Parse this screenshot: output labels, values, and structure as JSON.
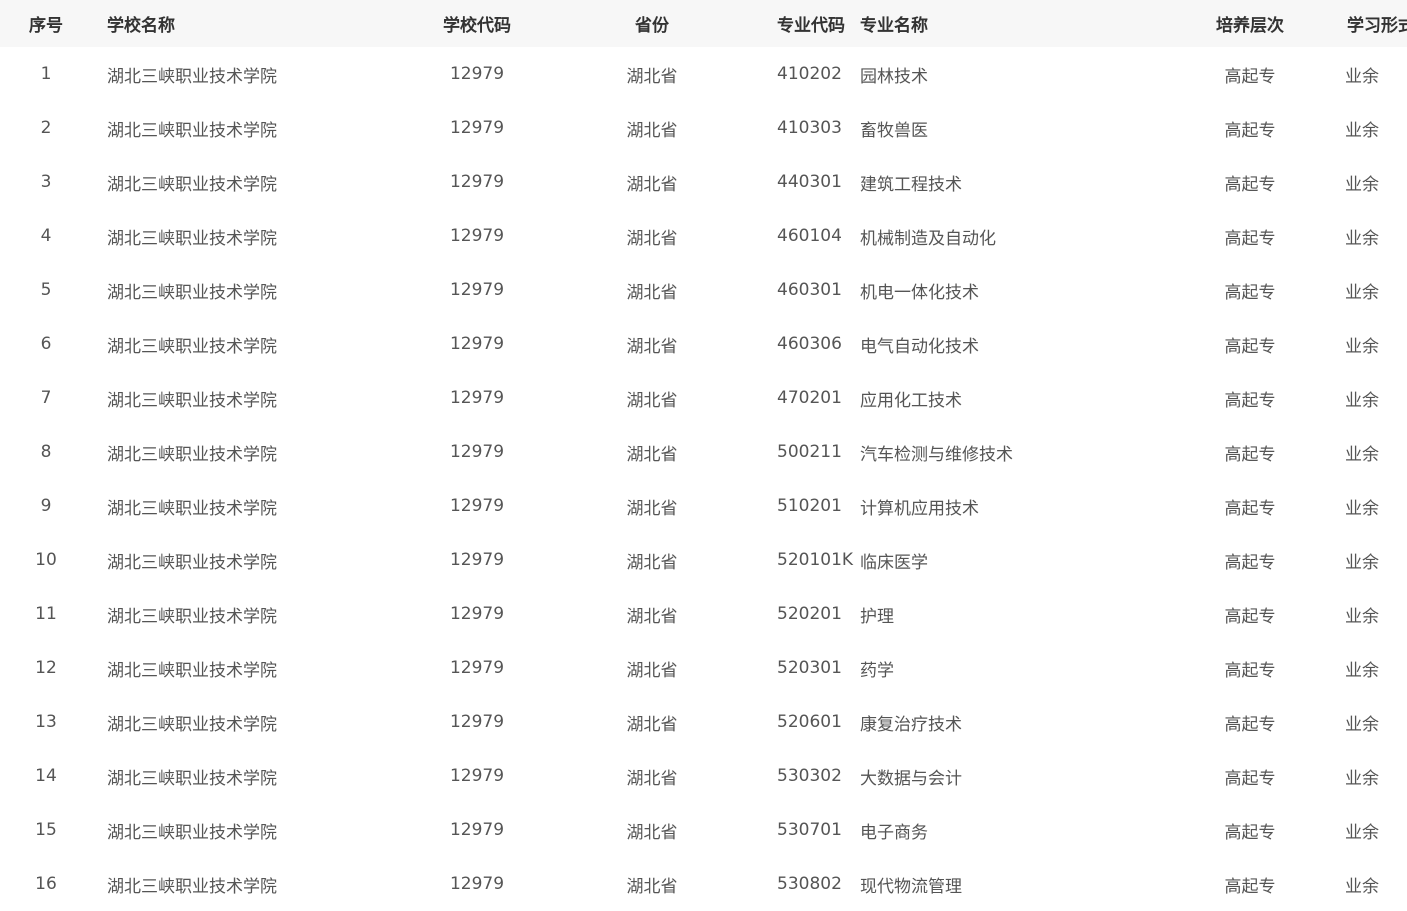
{
  "headers": {
    "index": "序号",
    "school_name": "学校名称",
    "school_code": "学校代码",
    "province": "省份",
    "major_code": "专业代码",
    "major_name": "专业名称",
    "level": "培养层次",
    "study_form": "学习形式"
  },
  "rows": [
    {
      "index": "1",
      "school_name": "湖北三峡职业技术学院",
      "school_code": "12979",
      "province": "湖北省",
      "major_code": "410202",
      "major_name": "园林技术",
      "level": "高起专",
      "study_form": "业余"
    },
    {
      "index": "2",
      "school_name": "湖北三峡职业技术学院",
      "school_code": "12979",
      "province": "湖北省",
      "major_code": "410303",
      "major_name": "畜牧兽医",
      "level": "高起专",
      "study_form": "业余"
    },
    {
      "index": "3",
      "school_name": "湖北三峡职业技术学院",
      "school_code": "12979",
      "province": "湖北省",
      "major_code": "440301",
      "major_name": "建筑工程技术",
      "level": "高起专",
      "study_form": "业余"
    },
    {
      "index": "4",
      "school_name": "湖北三峡职业技术学院",
      "school_code": "12979",
      "province": "湖北省",
      "major_code": "460104",
      "major_name": "机械制造及自动化",
      "level": "高起专",
      "study_form": "业余"
    },
    {
      "index": "5",
      "school_name": "湖北三峡职业技术学院",
      "school_code": "12979",
      "province": "湖北省",
      "major_code": "460301",
      "major_name": "机电一体化技术",
      "level": "高起专",
      "study_form": "业余"
    },
    {
      "index": "6",
      "school_name": "湖北三峡职业技术学院",
      "school_code": "12979",
      "province": "湖北省",
      "major_code": "460306",
      "major_name": "电气自动化技术",
      "level": "高起专",
      "study_form": "业余"
    },
    {
      "index": "7",
      "school_name": "湖北三峡职业技术学院",
      "school_code": "12979",
      "province": "湖北省",
      "major_code": "470201",
      "major_name": "应用化工技术",
      "level": "高起专",
      "study_form": "业余"
    },
    {
      "index": "8",
      "school_name": "湖北三峡职业技术学院",
      "school_code": "12979",
      "province": "湖北省",
      "major_code": "500211",
      "major_name": "汽车检测与维修技术",
      "level": "高起专",
      "study_form": "业余"
    },
    {
      "index": "9",
      "school_name": "湖北三峡职业技术学院",
      "school_code": "12979",
      "province": "湖北省",
      "major_code": "510201",
      "major_name": "计算机应用技术",
      "level": "高起专",
      "study_form": "业余"
    },
    {
      "index": "10",
      "school_name": "湖北三峡职业技术学院",
      "school_code": "12979",
      "province": "湖北省",
      "major_code": "520101K",
      "major_name": "临床医学",
      "level": "高起专",
      "study_form": "业余"
    },
    {
      "index": "11",
      "school_name": "湖北三峡职业技术学院",
      "school_code": "12979",
      "province": "湖北省",
      "major_code": "520201",
      "major_name": "护理",
      "level": "高起专",
      "study_form": "业余"
    },
    {
      "index": "12",
      "school_name": "湖北三峡职业技术学院",
      "school_code": "12979",
      "province": "湖北省",
      "major_code": "520301",
      "major_name": "药学",
      "level": "高起专",
      "study_form": "业余"
    },
    {
      "index": "13",
      "school_name": "湖北三峡职业技术学院",
      "school_code": "12979",
      "province": "湖北省",
      "major_code": "520601",
      "major_name": "康复治疗技术",
      "level": "高起专",
      "study_form": "业余"
    },
    {
      "index": "14",
      "school_name": "湖北三峡职业技术学院",
      "school_code": "12979",
      "province": "湖北省",
      "major_code": "530302",
      "major_name": "大数据与会计",
      "level": "高起专",
      "study_form": "业余"
    },
    {
      "index": "15",
      "school_name": "湖北三峡职业技术学院",
      "school_code": "12979",
      "province": "湖北省",
      "major_code": "530701",
      "major_name": "电子商务",
      "level": "高起专",
      "study_form": "业余"
    },
    {
      "index": "16",
      "school_name": "湖北三峡职业技术学院",
      "school_code": "12979",
      "province": "湖北省",
      "major_code": "530802",
      "major_name": "现代物流管理",
      "level": "高起专",
      "study_form": "业余"
    }
  ]
}
